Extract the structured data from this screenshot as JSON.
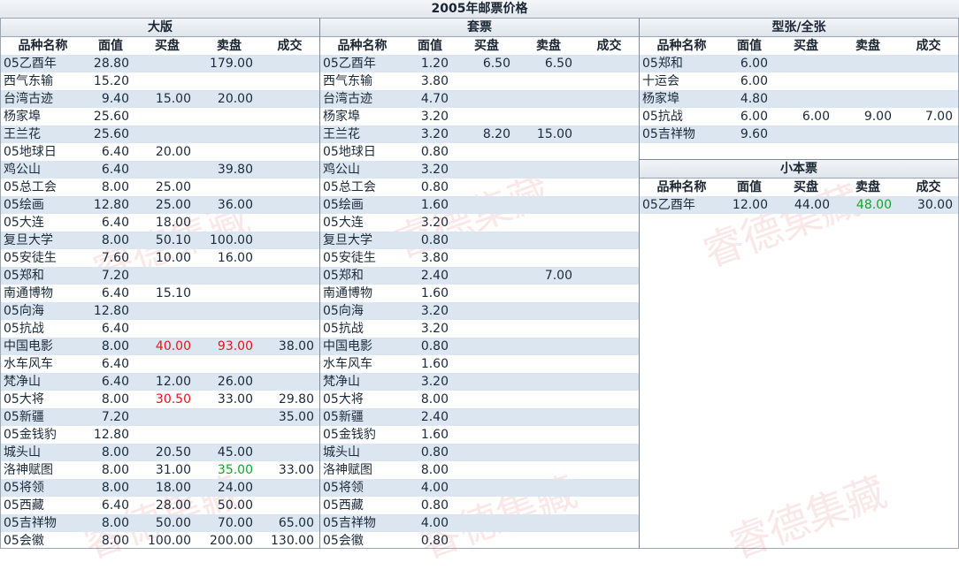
{
  "page_title": "2005年邮票价格",
  "columns": [
    "品种名称",
    "面值",
    "买盘",
    "卖盘",
    "成交"
  ],
  "watermark": "睿德集藏",
  "sections": {
    "large": {
      "title": "大版",
      "rows": [
        [
          "05乙酉年",
          "28.80",
          "",
          "179.00",
          ""
        ],
        [
          "西气东输",
          "15.20",
          "",
          "",
          ""
        ],
        [
          "台湾古迹",
          "9.40",
          "15.00",
          "20.00",
          ""
        ],
        [
          "杨家埠",
          "25.60",
          "",
          "",
          ""
        ],
        [
          "王兰花",
          "25.60",
          "",
          "",
          ""
        ],
        [
          "05地球日",
          "6.40",
          "20.00",
          "",
          ""
        ],
        [
          "鸡公山",
          "6.40",
          "",
          "39.80",
          ""
        ],
        [
          "05总工会",
          "8.00",
          "25.00",
          "",
          ""
        ],
        [
          "05绘画",
          "12.80",
          "25.00",
          "36.00",
          ""
        ],
        [
          "05大连",
          "6.40",
          "18.00",
          "",
          ""
        ],
        [
          "复旦大学",
          "8.00",
          "50.10",
          "100.00",
          ""
        ],
        [
          "05安徒生",
          "7.60",
          "10.00",
          "16.00",
          ""
        ],
        [
          "05郑和",
          "7.20",
          "",
          "",
          ""
        ],
        [
          "南通博物",
          "6.40",
          "15.10",
          "",
          ""
        ],
        [
          "05向海",
          "12.80",
          "",
          "",
          ""
        ],
        [
          "05抗战",
          "6.40",
          "",
          "",
          ""
        ],
        [
          "中国电影",
          "8.00",
          "40.00",
          "93.00",
          "38.00"
        ],
        [
          "水车风车",
          "6.40",
          "",
          "",
          ""
        ],
        [
          "梵净山",
          "6.40",
          "12.00",
          "26.00",
          ""
        ],
        [
          "05大将",
          "8.00",
          "30.50",
          "33.00",
          "29.80"
        ],
        [
          "05新疆",
          "7.20",
          "",
          "",
          "35.00"
        ],
        [
          "05金钱豹",
          "12.80",
          "",
          "",
          ""
        ],
        [
          "城头山",
          "8.00",
          "20.50",
          "45.00",
          ""
        ],
        [
          "洛神赋图",
          "8.00",
          "31.00",
          "35.00",
          "33.00"
        ],
        [
          "05将领",
          "8.00",
          "18.00",
          "24.00",
          ""
        ],
        [
          "05西藏",
          "6.40",
          "28.00",
          "50.00",
          ""
        ],
        [
          "05吉祥物",
          "8.00",
          "50.00",
          "70.00",
          "65.00"
        ],
        [
          "05会徽",
          "8.00",
          "100.00",
          "200.00",
          "130.00"
        ]
      ]
    },
    "set": {
      "title": "套票",
      "rows": [
        [
          "05乙酉年",
          "1.20",
          "6.50",
          "6.50",
          ""
        ],
        [
          "西气东输",
          "3.80",
          "",
          "",
          ""
        ],
        [
          "台湾古迹",
          "4.70",
          "",
          "",
          ""
        ],
        [
          "杨家埠",
          "3.20",
          "",
          "",
          ""
        ],
        [
          "王兰花",
          "3.20",
          "8.20",
          "15.00",
          ""
        ],
        [
          "05地球日",
          "0.80",
          "",
          "",
          ""
        ],
        [
          "鸡公山",
          "3.20",
          "",
          "",
          ""
        ],
        [
          "05总工会",
          "0.80",
          "",
          "",
          ""
        ],
        [
          "05绘画",
          "1.60",
          "",
          "",
          ""
        ],
        [
          "05大连",
          "3.20",
          "",
          "",
          ""
        ],
        [
          "复旦大学",
          "0.80",
          "",
          "",
          ""
        ],
        [
          "05安徒生",
          "3.80",
          "",
          "",
          ""
        ],
        [
          "05郑和",
          "2.40",
          "",
          "7.00",
          ""
        ],
        [
          "南通博物",
          "1.60",
          "",
          "",
          ""
        ],
        [
          "05向海",
          "3.20",
          "",
          "",
          ""
        ],
        [
          "05抗战",
          "3.20",
          "",
          "",
          ""
        ],
        [
          "中国电影",
          "0.80",
          "",
          "",
          ""
        ],
        [
          "水车风车",
          "1.60",
          "",
          "",
          ""
        ],
        [
          "梵净山",
          "3.20",
          "",
          "",
          ""
        ],
        [
          "05大将",
          "8.00",
          "",
          "",
          ""
        ],
        [
          "05新疆",
          "2.40",
          "",
          "",
          ""
        ],
        [
          "05金钱豹",
          "1.60",
          "",
          "",
          ""
        ],
        [
          "城头山",
          "0.80",
          "",
          "",
          ""
        ],
        [
          "洛神赋图",
          "8.00",
          "",
          "",
          ""
        ],
        [
          "05将领",
          "4.00",
          "",
          "",
          ""
        ],
        [
          "05西藏",
          "0.80",
          "",
          "",
          ""
        ],
        [
          "05吉祥物",
          "4.00",
          "",
          "",
          ""
        ],
        [
          "05会徽",
          "0.80",
          "",
          "",
          ""
        ]
      ]
    },
    "sheet": {
      "title": "型张/全张",
      "rows": [
        [
          "05郑和",
          "6.00",
          "",
          "",
          ""
        ],
        [
          "十运会",
          "6.00",
          "",
          "",
          ""
        ],
        [
          "杨家埠",
          "4.80",
          "",
          "",
          ""
        ],
        [
          "05抗战",
          "6.00",
          "6.00",
          "9.00",
          "7.00"
        ],
        [
          "05吉祥物",
          "9.60",
          "",
          "",
          ""
        ]
      ]
    },
    "booklet": {
      "title": "小本票",
      "rows": [
        [
          "05乙酉年",
          "12.00",
          "44.00",
          "48.00",
          "30.00"
        ]
      ]
    }
  },
  "highlights": {
    "red": [
      "large.16.2",
      "large.16.3",
      "large.19.2"
    ],
    "green": [
      "large.23.3",
      "booklet.0.3"
    ]
  }
}
